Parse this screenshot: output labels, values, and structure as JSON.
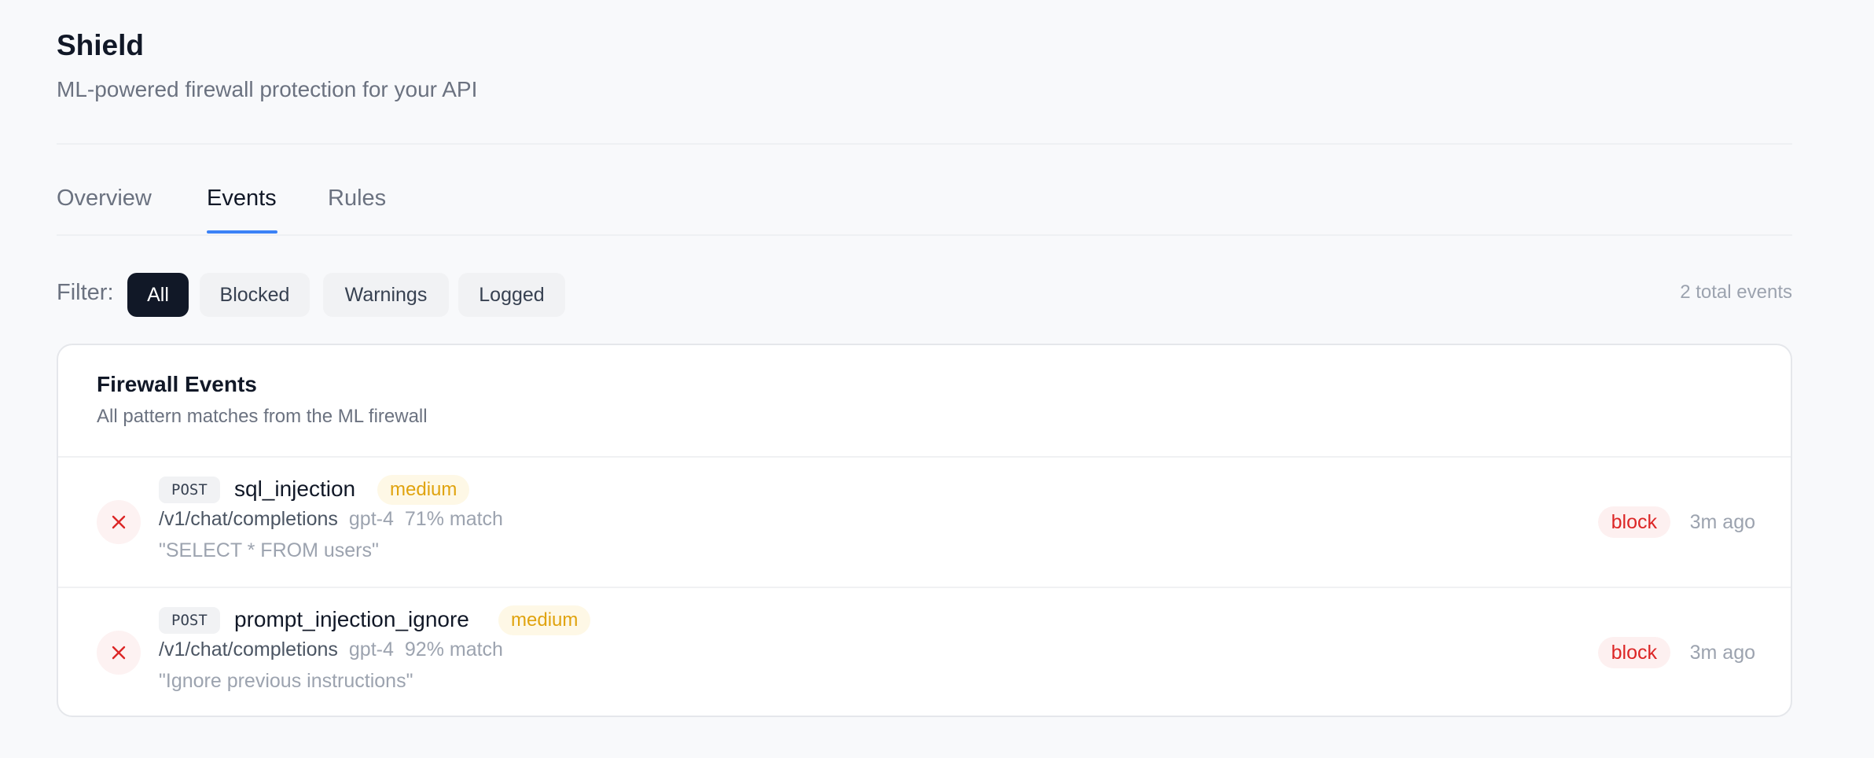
{
  "header": {
    "title": "Shield",
    "subtitle": "ML-powered firewall protection for your API"
  },
  "tabs": [
    {
      "label": "Overview",
      "active": false
    },
    {
      "label": "Events",
      "active": true
    },
    {
      "label": "Rules",
      "active": false
    }
  ],
  "filter": {
    "label": "Filter:",
    "options": [
      "All",
      "Blocked",
      "Warnings",
      "Logged"
    ],
    "selected": "All",
    "total_text": "2 total events"
  },
  "card": {
    "title": "Firewall Events",
    "subtitle": "All pattern matches from the ML firewall"
  },
  "events": [
    {
      "method": "POST",
      "rule": "sql_injection",
      "severity": "medium",
      "path": "/v1/chat/completions",
      "model": "gpt-4",
      "match": "71% match",
      "payload": "\"SELECT * FROM users\"",
      "action": "block",
      "time": "3m ago",
      "status_icon": "close-icon"
    },
    {
      "method": "POST",
      "rule": "prompt_injection_ignore",
      "severity": "medium",
      "path": "/v1/chat/completions",
      "model": "gpt-4",
      "match": "92% match",
      "payload": "\"Ignore previous instructions\"",
      "action": "block",
      "time": "3m ago",
      "status_icon": "close-icon"
    }
  ],
  "colors": {
    "accent": "#3b82f6",
    "block": "#dc2626",
    "medium": "#e0a30e",
    "active_chip": "#111827"
  }
}
